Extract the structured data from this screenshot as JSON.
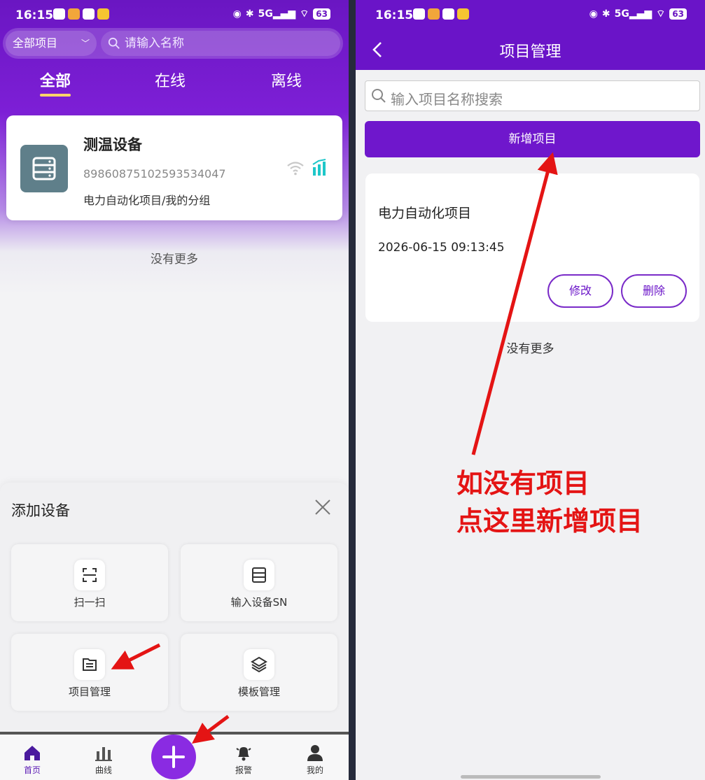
{
  "status_bar": {
    "time": "16:15",
    "signal_label": "5G",
    "battery": "63"
  },
  "left": {
    "filter": {
      "selected": "全部项目",
      "search_placeholder": "请输入名称"
    },
    "tabs": [
      "全部",
      "在线",
      "离线"
    ],
    "device": {
      "name": "测温设备",
      "sn": "89860875102593534047",
      "group": "电力自动化项目/我的分组"
    },
    "no_more": "没有更多",
    "sheet": {
      "title": "添加设备",
      "options": [
        "扫一扫",
        "输入设备SN",
        "项目管理",
        "模板管理"
      ]
    },
    "nav": [
      "首页",
      "曲线",
      "报警",
      "我的"
    ]
  },
  "right": {
    "title": "项目管理",
    "search_placeholder": "输入项目名称搜索",
    "add_button": "新增项目",
    "project": {
      "name": "电力自动化项目",
      "time": "2026-06-15 09:13:45",
      "edit": "修改",
      "delete": "删除"
    },
    "no_more": "没有更多",
    "annotation": [
      "如没有项目",
      "点这里新增项目"
    ]
  },
  "colors": {
    "brand_purple": "#6a14c8",
    "annotation_red": "#e41414",
    "active_tab_underline": "#fbd36a",
    "device_icon_bg": "#5f7f8a"
  }
}
